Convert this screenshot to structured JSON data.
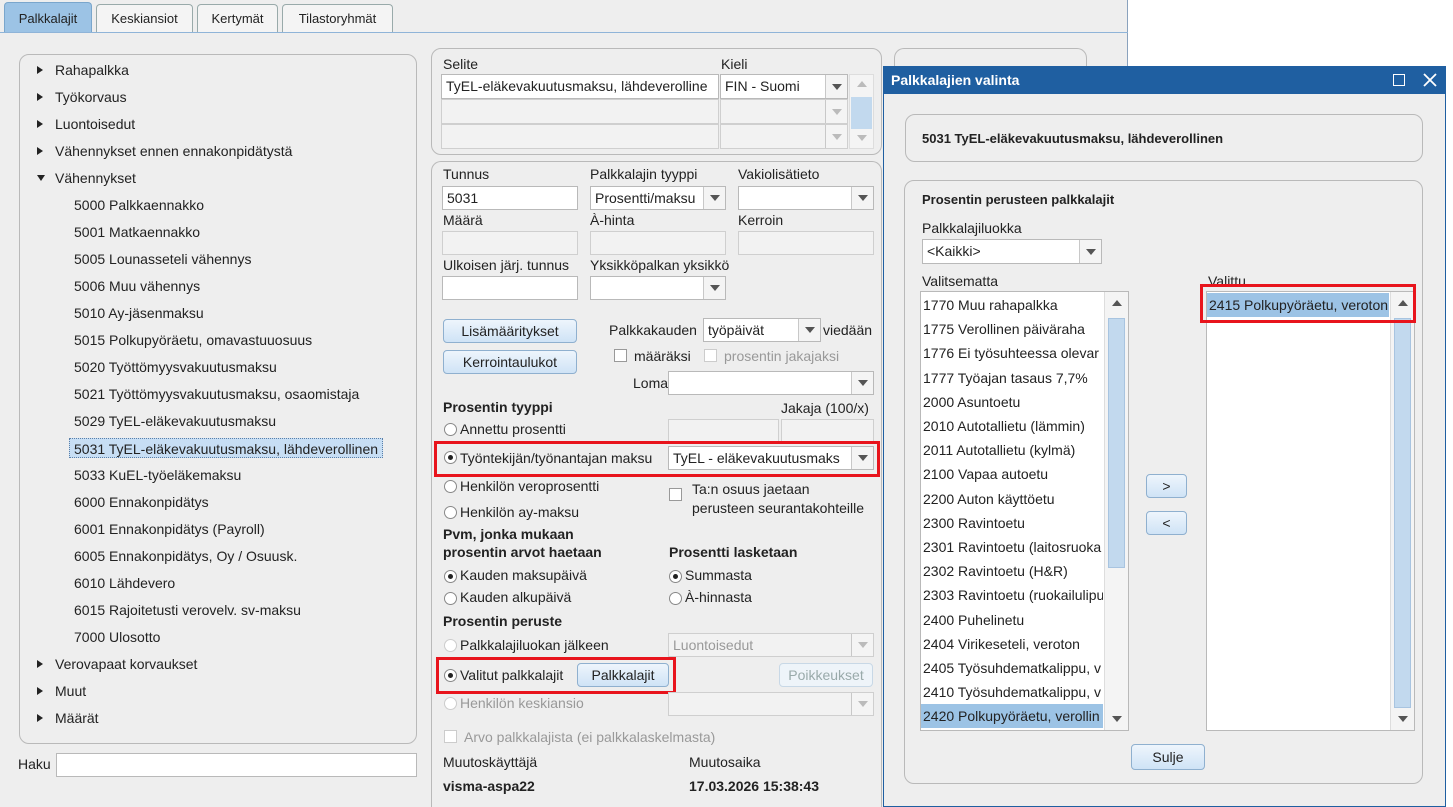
{
  "tabs": [
    "Palkkalajit",
    "Keskiansiot",
    "Kertymät",
    "Tilastoryhmät"
  ],
  "tree": {
    "items": [
      {
        "label": "Rahapalkka",
        "type": "collapsed"
      },
      {
        "label": "Työkorvaus",
        "type": "collapsed"
      },
      {
        "label": "Luontoisedut",
        "type": "collapsed"
      },
      {
        "label": "Vähennykset ennen ennakonpidätystä",
        "type": "collapsed"
      },
      {
        "label": "Vähennykset",
        "type": "expanded"
      },
      {
        "label": "5000 Palkkaennakko",
        "type": "child"
      },
      {
        "label": "5001 Matkaennakko",
        "type": "child"
      },
      {
        "label": "5005 Lounasseteli vähennys",
        "type": "child"
      },
      {
        "label": "5006 Muu vähennys",
        "type": "child"
      },
      {
        "label": "5010 Ay-jäsenmaksu",
        "type": "child"
      },
      {
        "label": "5015 Polkupyöräetu, omavastuuosuus",
        "type": "child"
      },
      {
        "label": "5020 Työttömyysvakuutusmaksu",
        "type": "child"
      },
      {
        "label": "5021 Työttömyysvakuutusmaksu, osaomistaja",
        "type": "child"
      },
      {
        "label": "5029 TyEL-eläkevakuutusmaksu",
        "type": "child"
      },
      {
        "label": "5031 TyEL-eläkevakuutusmaksu, lähdeverollinen",
        "type": "selected"
      },
      {
        "label": "5033 KuEL-työeläkemaksu",
        "type": "child"
      },
      {
        "label": "6000 Ennakonpidätys",
        "type": "child"
      },
      {
        "label": "6001 Ennakonpidätys (Payroll)",
        "type": "child"
      },
      {
        "label": "6005 Ennakonpidätys, Oy / Osuusk.",
        "type": "child"
      },
      {
        "label": "6010 Lähdevero",
        "type": "child"
      },
      {
        "label": "6015 Rajoitetusti verovelv. sv-maksu",
        "type": "child"
      },
      {
        "label": "7000 Ulosotto",
        "type": "child"
      },
      {
        "label": "Verovapaat korvaukset",
        "type": "collapsed"
      },
      {
        "label": "Muut",
        "type": "collapsed"
      },
      {
        "label": "Määrät",
        "type": "collapsed"
      }
    ]
  },
  "search": {
    "label": "Haku",
    "value": ""
  },
  "desc": {
    "selite_label": "Selite",
    "kieli_label": "Kieli",
    "selite_value": "TyEL-eläkevakuutusmaksu, lähdeverolline",
    "kieli_value": "FIN - Suomi"
  },
  "form": {
    "tunnus_label": "Tunnus",
    "tunnus_value": "5031",
    "tyyppi_label": "Palkkalajin tyyppi",
    "tyyppi_value": "Prosentti/maksu",
    "vakio_label": "Vakiolisätieto",
    "vakio_value": "",
    "maara_label": "Määrä",
    "ahinta_label": "À-hinta",
    "kerroin_label": "Kerroin",
    "ulk_label": "Ulkoisen järj. tunnus",
    "yks_label": "Yksikköpalkan yksikkö",
    "lisa_btn": "Lisämääritykset",
    "kerroin_btn": "Kerrointaulukot",
    "palkkakauden_label": "Palkkakauden",
    "palkkakauden_value": "työpäivät",
    "viedaan_label": "viedään",
    "maaraksi_label": "määräksi",
    "prosentin_jakajaksi_label": "prosentin jakajaksi",
    "loma_label": "Loma",
    "loma_value": "",
    "prosentin_tyyppi_label": "Prosentin tyyppi",
    "jakaja_label": "Jakaja (100/x)",
    "r_annettu": "Annettu prosentti",
    "r_tyontekijan": "Työntekijän/työnantajan maksu",
    "tyel_value": "TyEL - eläkevakuutusmaks",
    "r_vero": "Henkilön veroprosentti",
    "r_ay": "Henkilön ay-maksu",
    "taan_label1": "Ta:n osuus jaetaan",
    "taan_label2": "perusteen seurantakohteille",
    "pvm_label1": "Pvm, jonka mukaan",
    "pvm_label2": "prosentin arvot haetaan",
    "r_maksupaiva": "Kauden maksupäivä",
    "r_alkupaiva": "Kauden alkupäivä",
    "lasketaan_label": "Prosentti lasketaan",
    "r_summasta": "Summasta",
    "r_ahinnasta": "À-hinnasta",
    "peruste_label": "Prosentin peruste",
    "r_luokan": "Palkkalajiluokan jälkeen",
    "luokka_value": "Luontoisedut",
    "r_valitut": "Valitut palkkalajit",
    "palkkalajit_btn": "Palkkalajit",
    "poikkeukset_btn": "Poikkeukset",
    "r_keskiansio": "Henkilön keskiansio",
    "arvo_label": "Arvo palkkalajista (ei palkkalaskelmasta)",
    "muutoskayttaja_label": "Muutoskäyttäjä",
    "muutoskayttaja_value": "visma-aspa22",
    "muutosaika_label": "Muutosaika",
    "muutosaika_value": "17.03.2026 15:38:43"
  },
  "dialog": {
    "title": "Palkkalajien valinta",
    "header": "5031 TyEL-eläkevakuutusmaksu, lähdeverollinen",
    "section_title": "Prosentin perusteen palkkalajit",
    "luokka_label": "Palkkalajiluokka",
    "luokka_value": "<Kaikki>",
    "valitsematta_label": "Valitsematta",
    "valittu_label": "Valittu",
    "valitsematta": [
      "1770 Muu rahapalkka",
      "1775 Verollinen päiväraha",
      "1776 Ei työsuhteessa olevar",
      "1777 Työajan tasaus 7,7%",
      "2000 Asuntoetu",
      "2010 Autotallietu (lämmin)",
      "2011 Autotallietu (kylmä)",
      "2100 Vapaa autoetu",
      "2200 Auton käyttöetu",
      "2300 Ravintoetu",
      "2301 Ravintoetu (laitosruoka",
      "2302 Ravintoetu (H&R)",
      "2303 Ravintoetu (ruokailulipu",
      "2400 Puhelinetu",
      "2404 Virikeseteli, veroton",
      "2405 Työsuhdematkalippu, v",
      "2410 Työsuhdematkalippu, v",
      "2420 Polkupyöräetu, verollin"
    ],
    "valittu": [
      "2415 Polkupyöräetu, veroton"
    ],
    "add_btn": ">",
    "remove_btn": "<",
    "close_btn": "Sulje"
  }
}
